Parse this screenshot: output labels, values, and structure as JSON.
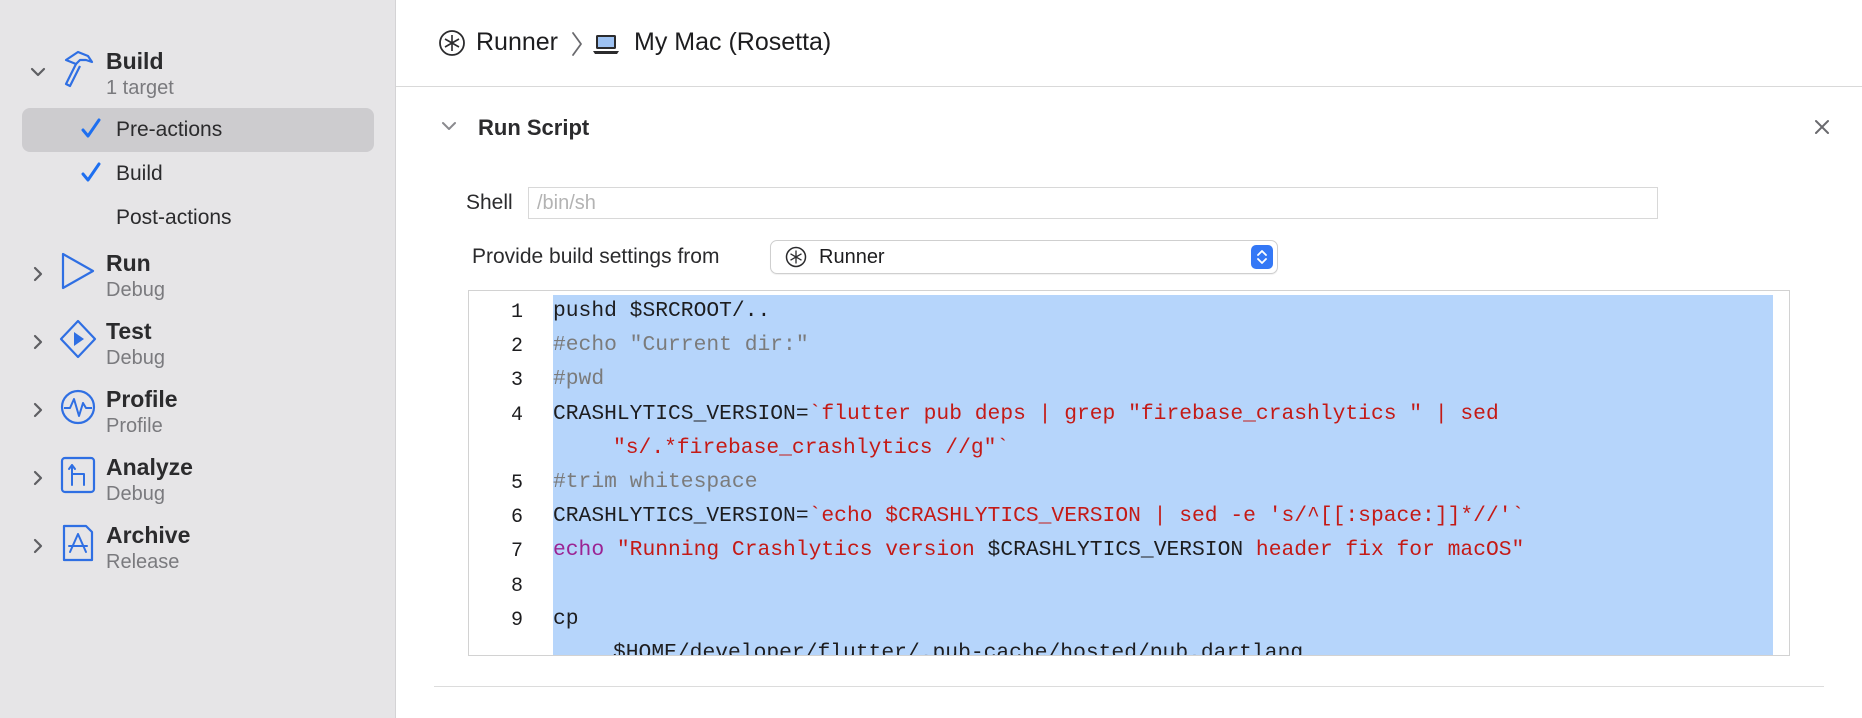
{
  "sidebar": {
    "groups": [
      {
        "icon": "hammer-icon",
        "title": "Build",
        "subtitle": "1 target",
        "expanded": true
      },
      {
        "icon": "play-icon",
        "title": "Run",
        "subtitle": "Debug",
        "expanded": false
      },
      {
        "icon": "test-diamond-icon",
        "title": "Test",
        "subtitle": "Debug",
        "expanded": false
      },
      {
        "icon": "profile-waveform-icon",
        "title": "Profile",
        "subtitle": "Profile",
        "expanded": false
      },
      {
        "icon": "analyze-branch-icon",
        "title": "Analyze",
        "subtitle": "Debug",
        "expanded": false
      },
      {
        "icon": "archive-app-icon",
        "title": "Archive",
        "subtitle": "Release",
        "expanded": false
      }
    ],
    "build_items": [
      {
        "label": "Pre-actions",
        "checked": true,
        "selected": true
      },
      {
        "label": "Build",
        "checked": true,
        "selected": false
      },
      {
        "label": "Post-actions",
        "checked": false,
        "selected": false
      }
    ]
  },
  "header": {
    "scheme": "Runner",
    "destination": "My Mac (Rosetta)"
  },
  "phase": {
    "title": "Run Script",
    "shell_label": "Shell",
    "shell_value": "",
    "shell_placeholder": "/bin/sh",
    "build_settings_label": "Provide build settings from",
    "build_settings_value": "Runner"
  },
  "script": {
    "lines": [
      {
        "num": "1",
        "rows": [
          [
            {
              "t": "pushd $SRCROOT/..",
              "k": "plain"
            }
          ]
        ]
      },
      {
        "num": "2",
        "rows": [
          [
            {
              "t": "#echo \"Current dir:\"",
              "k": "comment"
            }
          ]
        ]
      },
      {
        "num": "3",
        "rows": [
          [
            {
              "t": "#pwd",
              "k": "comment"
            }
          ]
        ]
      },
      {
        "num": "4",
        "rows": [
          [
            {
              "t": "CRASHLYTICS_VERSION=",
              "k": "plain"
            },
            {
              "t": "`flutter pub deps | grep \"firebase_crashlytics \" | sed",
              "k": "string"
            }
          ],
          [
            {
              "t": "\"s/.*firebase_crashlytics //g\"`",
              "k": "string"
            }
          ]
        ]
      },
      {
        "num": "5",
        "rows": [
          [
            {
              "t": "#trim whitespace",
              "k": "comment"
            }
          ]
        ]
      },
      {
        "num": "6",
        "rows": [
          [
            {
              "t": "CRASHLYTICS_VERSION=",
              "k": "plain"
            },
            {
              "t": "`echo $CRASHLYTICS_VERSION | sed -e 's/^[[:space:]]*//'`",
              "k": "string"
            }
          ]
        ]
      },
      {
        "num": "7",
        "rows": [
          [
            {
              "t": "echo",
              "k": "keyword"
            },
            {
              "t": " \"Running Crashlytics version ",
              "k": "string"
            },
            {
              "t": "$CRASHLYTICS_VERSION",
              "k": "plain"
            },
            {
              "t": " header fix for macOS\"",
              "k": "string"
            }
          ]
        ]
      },
      {
        "num": "8",
        "rows": [
          [
            {
              "t": "",
              "k": "plain"
            }
          ]
        ]
      },
      {
        "num": "9",
        "rows": [
          [
            {
              "t": "cp",
              "k": "plain"
            }
          ],
          [
            {
              "t": "$HOME/developer/flutter/.pub-cache/hosted/pub.dartlang",
              "k": "plain"
            }
          ]
        ]
      }
    ]
  },
  "colors": {
    "accent": "#3478f6",
    "selection": "#b6d5fb",
    "sidebar_bg": "#e6e5e7",
    "string": "#c41a16",
    "comment": "#7b7b7b",
    "keyword": "#9b2393"
  }
}
